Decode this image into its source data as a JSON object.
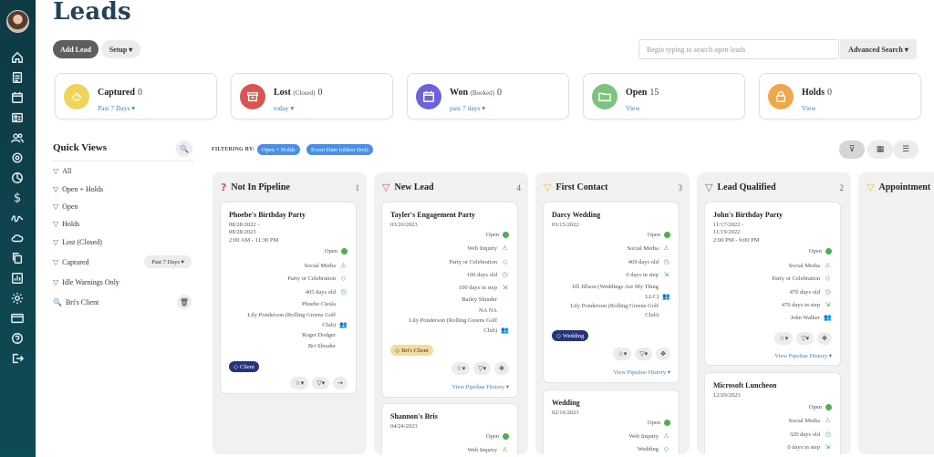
{
  "page": {
    "title": "Leads"
  },
  "toolbar": {
    "add_lead": "Add Lead",
    "setup": "Setup",
    "search_placeholder": "Begin typing to search open leads",
    "advanced_search": "Advanced Search"
  },
  "stats": [
    {
      "label": "Captured",
      "sub": "",
      "count": "0",
      "link": "Past 7 Days",
      "has_caret": true,
      "color": "#f0d35a",
      "icon": "captured-icon"
    },
    {
      "label": "Lost",
      "sub": "(Closed)",
      "count": "0",
      "link": "today",
      "has_caret": true,
      "color": "#d9534f",
      "icon": "archive-icon"
    },
    {
      "label": "Won",
      "sub": "(Booked)",
      "count": "0",
      "link": "past 7 days",
      "has_caret": true,
      "color": "#6b63d9",
      "icon": "calendar-icon"
    },
    {
      "label": "Open",
      "sub": "",
      "count": "15",
      "link": "View",
      "has_caret": false,
      "color": "#7cc47d",
      "icon": "folder-icon"
    },
    {
      "label": "Holds",
      "sub": "",
      "count": "0",
      "link": "View",
      "has_caret": false,
      "color": "#f0a64a",
      "icon": "holds-icon"
    }
  ],
  "quick_views": {
    "title": "Quick Views",
    "items": [
      "All",
      "Open + Holds",
      "Open",
      "Holds",
      "Lost (Closed)",
      "Captured",
      "Idle Warnings Only",
      "Bri's Client"
    ],
    "captured_range": "Past 7 Days"
  },
  "filters": {
    "label": "FILTERING BY:",
    "chips": [
      "Open + Holds",
      "Event Date (oldest first)"
    ]
  },
  "columns": [
    {
      "name": "Not In Pipeline",
      "count": "1",
      "icon_color": "#d9534f",
      "icon": "?",
      "cards": [
        {
          "title": "Phoebe's Birthday Party",
          "date_lines": [
            "08/28/2022 -",
            "08/28/2023",
            "2:00 AM - 11:30 PM"
          ],
          "rows": [
            "Open",
            "Social Media",
            "Party or Celebration",
            "405 days old",
            "Phoebe Ciesla",
            "Lily Ponderson (Rolling Greens Golf",
            "Club)",
            "Roger Dodger",
            "Bri Shrader"
          ],
          "tag": "Client"
        }
      ]
    },
    {
      "name": "New Lead",
      "count": "4",
      "icon_color": "#d9534f",
      "icon": "▽",
      "cards": [
        {
          "title": "Tayler's Engagement Party",
          "date_lines": [
            "03/20/2023"
          ],
          "rows": [
            "Open",
            "Web Inquiry",
            "Party or Celebration",
            "100 days old",
            "100 days in step",
            "Bailey Shrader",
            "NA NA",
            "Lily Ponderson (Rolling Greens Golf",
            "Club)"
          ],
          "tag": "Bri's Client",
          "history": "View Pipeline History"
        },
        {
          "title": "Shannon's Bris",
          "date_lines": [
            "04/24/2023"
          ],
          "rows": [
            "Open",
            "Web Inquiry"
          ]
        }
      ]
    },
    {
      "name": "First Contact",
      "count": "3",
      "icon_color": "#f0c43a",
      "icon": "▽",
      "cards": [
        {
          "title": "Darcy Wedding",
          "date_lines": [
            "03/15/2022"
          ],
          "rows": [
            "Open",
            "Social Media",
            "469 days old",
            "0 days in step",
            "Jill Jillson (Weddings Are My Thing",
            "LLC)",
            "Lily Ponderson (Rolling Greens Golf",
            "Club)"
          ],
          "tag": "Wedding",
          "history": "View Pipeline History"
        },
        {
          "title": "Wedding",
          "date_lines": [
            "02/16/2023"
          ],
          "rows": [
            "Open",
            "Web Inquiry",
            "Wedding"
          ]
        }
      ]
    },
    {
      "name": "Lead Qualified",
      "count": "2",
      "icon_color": "#777777",
      "icon": "▽",
      "cards": [
        {
          "title": "John's Birthday Party",
          "date_lines": [
            "11/17/2022 -",
            "11/19/2022",
            "2:00 PM - 9:00 PM"
          ],
          "rows": [
            "Open",
            "Social Media",
            "Party or Celebration",
            "470 days old",
            "470 days in step",
            "John Walker"
          ],
          "history": "View Pipeline History"
        },
        {
          "title": "Microsoft Luncheon",
          "date_lines": [
            "12/29/2023"
          ],
          "rows": [
            "Open",
            "Social Media",
            "320 days old",
            "0 days in step"
          ]
        }
      ]
    },
    {
      "name": "Appointment",
      "count": "",
      "icon_color": "#f0c43a",
      "icon": "▽",
      "cards": []
    }
  ]
}
